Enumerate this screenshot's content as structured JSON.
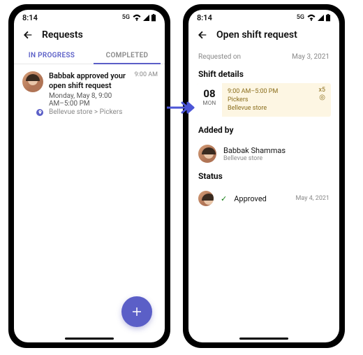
{
  "leftPhone": {
    "statusTime": "8:14",
    "network": "5G",
    "headerTitle": "Requests",
    "tabs": {
      "inProgress": "IN PROGRESS",
      "completed": "COMPLETED"
    },
    "notification": {
      "title": "Babbak approved your open shift request",
      "subtitle": "Monday, May 8, 9:00 AM–5:00 PM",
      "location": "Bellevue store > Pickers",
      "time": "9:00 AM"
    }
  },
  "rightPhone": {
    "statusTime": "8:14",
    "network": "5G",
    "headerTitle": "Open shift request",
    "requestedOnLabel": "Requested on",
    "requestedOnDate": "May 3, 2021",
    "shiftDetailsLabel": "Shift details",
    "shift": {
      "dayNum": "08",
      "dow": "MON",
      "time": "9:00 AM–5:00 PM",
      "group": "Pickers",
      "store": "Bellevue store",
      "count": "x5"
    },
    "addedByLabel": "Added by",
    "addedBy": {
      "name": "Babbak Shammas",
      "store": "Bellevue store"
    },
    "statusLabel": "Status",
    "status": {
      "text": "Approved",
      "date": "May 4, 2021"
    }
  }
}
